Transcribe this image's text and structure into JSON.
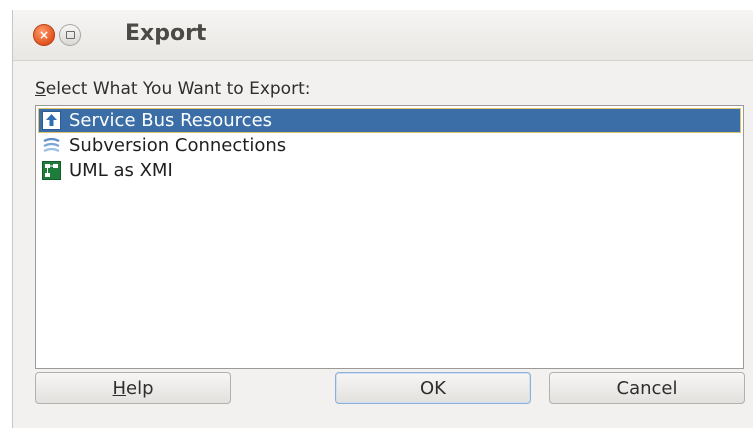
{
  "window": {
    "title": "Export",
    "close_glyph": "×"
  },
  "prompt": {
    "mnemonic": "S",
    "rest": "elect What You Want to Export:"
  },
  "items": [
    {
      "label": "Service Bus Resources",
      "icon": "upload-arrow-icon",
      "selected": true
    },
    {
      "label": "Subversion Connections",
      "icon": "subversion-icon",
      "selected": false
    },
    {
      "label": "UML as XMI",
      "icon": "uml-diagram-icon",
      "selected": false
    }
  ],
  "buttons": {
    "help_mnemonic": "H",
    "help_rest": "elp",
    "ok": "OK",
    "cancel": "Cancel"
  },
  "colors": {
    "selection": "#3b6ea7",
    "dialog_bg": "#f2f1f0",
    "close_button": "#e2541f"
  }
}
